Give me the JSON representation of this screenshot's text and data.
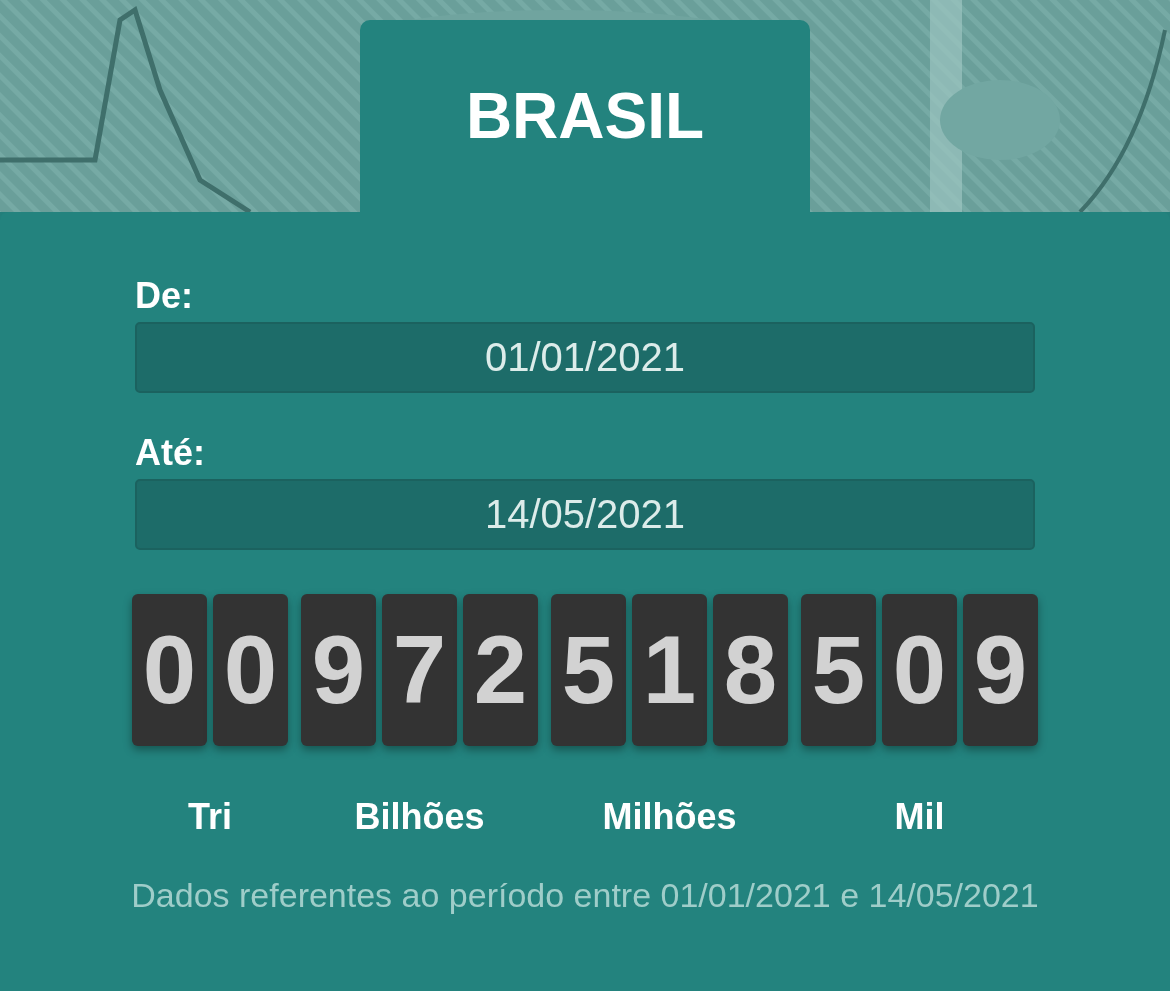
{
  "title": "BRASIL",
  "fields": [
    {
      "label": "De:",
      "value": "01/01/2021"
    },
    {
      "label": "Até:",
      "value": "14/05/2021"
    }
  ],
  "counter": [
    {
      "label": "Tri",
      "digits": [
        "0",
        "0"
      ]
    },
    {
      "label": "Bilhões",
      "digits": [
        "9",
        "7",
        "2"
      ]
    },
    {
      "label": "Milhões",
      "digits": [
        "5",
        "1",
        "8"
      ]
    },
    {
      "label": "Mil",
      "digits": [
        "5",
        "0",
        "9"
      ]
    }
  ],
  "footnote": "Dados referentes ao período entre 01/01/2021 e 14/05/2021"
}
